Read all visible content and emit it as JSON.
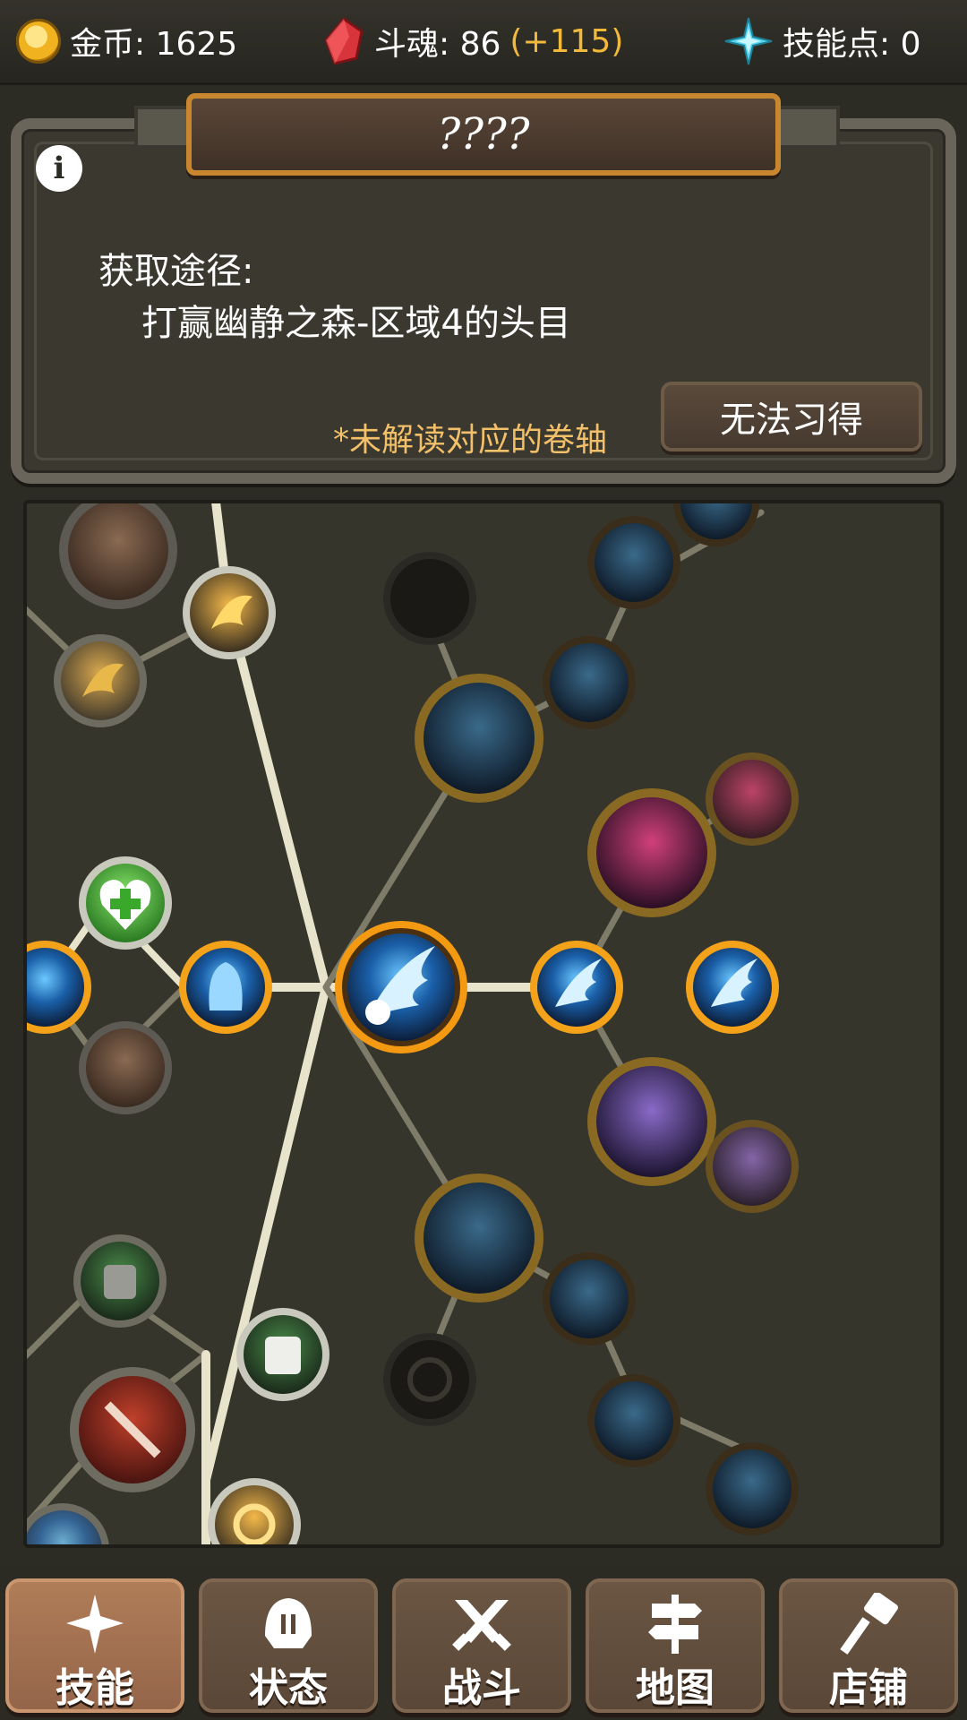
{
  "topbar": {
    "gold_label": "金币: 1625",
    "soul_label": "斗魂: 86",
    "soul_bonus": "(+115)",
    "skill_points_label": "技能点: 0"
  },
  "panel": {
    "title": "????",
    "source_label": "获取途径:",
    "source_value": "打赢幽静之森-区域4的头目",
    "note": "*未解读对应的卷轴",
    "learn_button": "无法习得"
  },
  "nav": {
    "tabs": [
      {
        "label": "技能",
        "icon": "sparkle-icon",
        "active": true
      },
      {
        "label": "状态",
        "icon": "helmet-icon",
        "active": false
      },
      {
        "label": "战斗",
        "icon": "crossed-swords-icon",
        "active": false
      },
      {
        "label": "地图",
        "icon": "signpost-icon",
        "active": false
      },
      {
        "label": "店铺",
        "icon": "hammer-icon",
        "active": false
      }
    ]
  },
  "colors": {
    "accent_gold": "#f3b93a",
    "note_text": "#f3c06a",
    "active_tab": "#a0704f"
  }
}
